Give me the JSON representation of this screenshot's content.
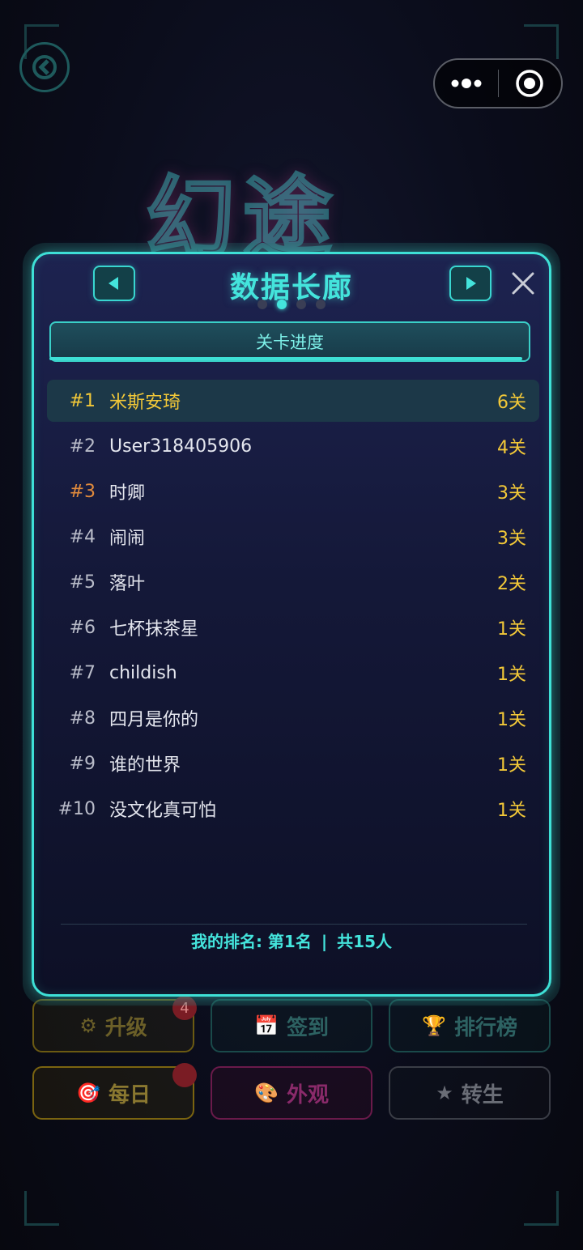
{
  "background": {
    "logo_text": "幻途",
    "buttons": [
      {
        "label": "升级",
        "icon": "gear-icon",
        "glyph": "⚙"
      },
      {
        "label": "签到",
        "icon": "calendar-icon",
        "glyph": "📅"
      },
      {
        "label": "排行榜",
        "icon": "trophy-icon",
        "glyph": "🏆"
      },
      {
        "label": "每日",
        "icon": "target-icon",
        "glyph": "🎯"
      },
      {
        "label": "外观",
        "icon": "palette-icon",
        "glyph": "🎨"
      },
      {
        "label": "转生",
        "icon": "star-icon",
        "glyph": "★"
      }
    ],
    "upgrade_badge": "4"
  },
  "panel": {
    "title": "数据长廊",
    "page_count": 4,
    "active_page": 2,
    "tab_label": "关卡进度",
    "rows": [
      {
        "rank": "#1",
        "name": "米斯安琦",
        "score": "6关"
      },
      {
        "rank": "#2",
        "name": "User318405906",
        "score": "4关"
      },
      {
        "rank": "#3",
        "name": "时卿",
        "score": "3关"
      },
      {
        "rank": "#4",
        "name": "闹闹",
        "score": "3关"
      },
      {
        "rank": "#5",
        "name": "落叶",
        "score": "2关"
      },
      {
        "rank": "#6",
        "name": "七杯抹茶星",
        "score": "1关"
      },
      {
        "rank": "#7",
        "name": "childish",
        "score": "1关"
      },
      {
        "rank": "#8",
        "name": "四月是你的",
        "score": "1关"
      },
      {
        "rank": "#9",
        "name": "谁的世界",
        "score": "1关"
      },
      {
        "rank": "#10",
        "name": "没文化真可怕",
        "score": "1关"
      }
    ],
    "my_rank": "我的排名: 第1名",
    "separator": "|",
    "total": "共15人"
  },
  "colors": {
    "accent": "#44e4dc",
    "gold": "#f2c838",
    "bronze": "#e08a3c"
  }
}
